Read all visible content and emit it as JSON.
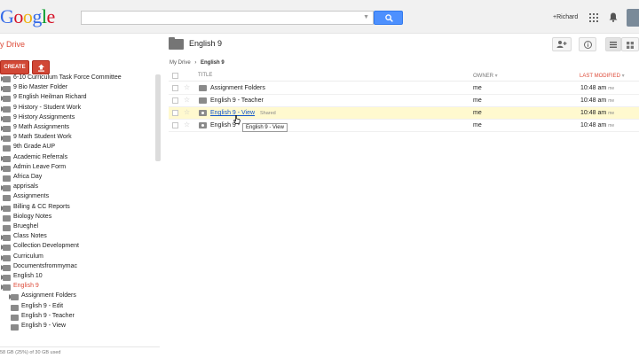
{
  "header": {
    "logo_letters": [
      {
        "ch": "G",
        "color": "#3369e8"
      },
      {
        "ch": "o",
        "color": "#d50f25"
      },
      {
        "ch": "o",
        "color": "#eeb211"
      },
      {
        "ch": "g",
        "color": "#3369e8"
      },
      {
        "ch": "l",
        "color": "#009925"
      },
      {
        "ch": "e",
        "color": "#d50f25"
      }
    ],
    "search": {
      "value": "",
      "placeholder": ""
    },
    "user": "+Richard"
  },
  "sidebar": {
    "app_label": "y Drive",
    "create_label": "CREATE",
    "quota": "58 GB (25%) of 30 GB used",
    "tree": [
      {
        "label": "6-10 Curriculum Task Force Committee",
        "level": 0,
        "arrow": true
      },
      {
        "label": "9 Bio Master Folder",
        "level": 0,
        "arrow": true
      },
      {
        "label": "9 English Heilman Richard",
        "level": 0,
        "arrow": true
      },
      {
        "label": "9 History - Student Work",
        "level": 0,
        "arrow": true
      },
      {
        "label": "9 History Assignments",
        "level": 0,
        "arrow": true
      },
      {
        "label": "9 Math Assignments",
        "level": 0,
        "arrow": true
      },
      {
        "label": "9 Math Student Work",
        "level": 0,
        "arrow": true
      },
      {
        "label": "9th Grade AUP",
        "level": 0,
        "arrow": false
      },
      {
        "label": "Academic Referrals",
        "level": 0,
        "arrow": true
      },
      {
        "label": "Admin Leave Form",
        "level": 0,
        "arrow": true
      },
      {
        "label": "Africa Day",
        "level": 0,
        "arrow": false
      },
      {
        "label": "apprisals",
        "level": 0,
        "arrow": true
      },
      {
        "label": "Assignments",
        "level": 0,
        "arrow": false
      },
      {
        "label": "Billing & CC Reports",
        "level": 0,
        "arrow": true
      },
      {
        "label": "Biology Notes",
        "level": 0,
        "arrow": false
      },
      {
        "label": "Brueghel",
        "level": 0,
        "arrow": false
      },
      {
        "label": "Class Notes",
        "level": 0,
        "arrow": true
      },
      {
        "label": "Collection Development",
        "level": 0,
        "arrow": true
      },
      {
        "label": "Curriculum",
        "level": 0,
        "arrow": true
      },
      {
        "label": "Documentsfrommymac",
        "level": 0,
        "arrow": true
      },
      {
        "label": "English 10",
        "level": 0,
        "arrow": true
      },
      {
        "label": "English 9",
        "level": 0,
        "arrow": true,
        "active": true
      },
      {
        "label": "Assignment Folders",
        "level": 1,
        "arrow": true
      },
      {
        "label": "English 9 - Edit",
        "level": 1,
        "arrow": false
      },
      {
        "label": "English 9 - Teacher",
        "level": 1,
        "arrow": false
      },
      {
        "label": "English 9 - View",
        "level": 1,
        "arrow": false
      }
    ]
  },
  "main": {
    "folder_title": "English 9",
    "breadcrumb": {
      "root": "My Drive",
      "sep": "›",
      "current": "English 9"
    },
    "columns": {
      "title": "TITLE",
      "owner": "OWNER",
      "modified": "LAST MODIFIED"
    },
    "files": [
      {
        "name": "Assignment Folders",
        "owner": "me",
        "modified": "10:48 am",
        "modified_by": "me",
        "shared": false,
        "shared_label": ""
      },
      {
        "name": "English 9 - Teacher",
        "owner": "me",
        "modified": "10:48 am",
        "modified_by": "me",
        "shared": false,
        "shared_label": ""
      },
      {
        "name": "English 9 - View",
        "owner": "me",
        "modified": "10:48 am",
        "modified_by": "me",
        "shared": true,
        "shared_label": "Shared",
        "hover": true
      },
      {
        "name": "English 9 -",
        "owner": "me",
        "modified": "10:48 am",
        "modified_by": "me",
        "shared": true,
        "shared_label": ""
      }
    ],
    "tooltip": "English 9 - View"
  },
  "colors": {
    "accent": "#dd4b39",
    "create": "#d14836",
    "search": "#4d90fe",
    "hover_row": "#fff9cf"
  }
}
